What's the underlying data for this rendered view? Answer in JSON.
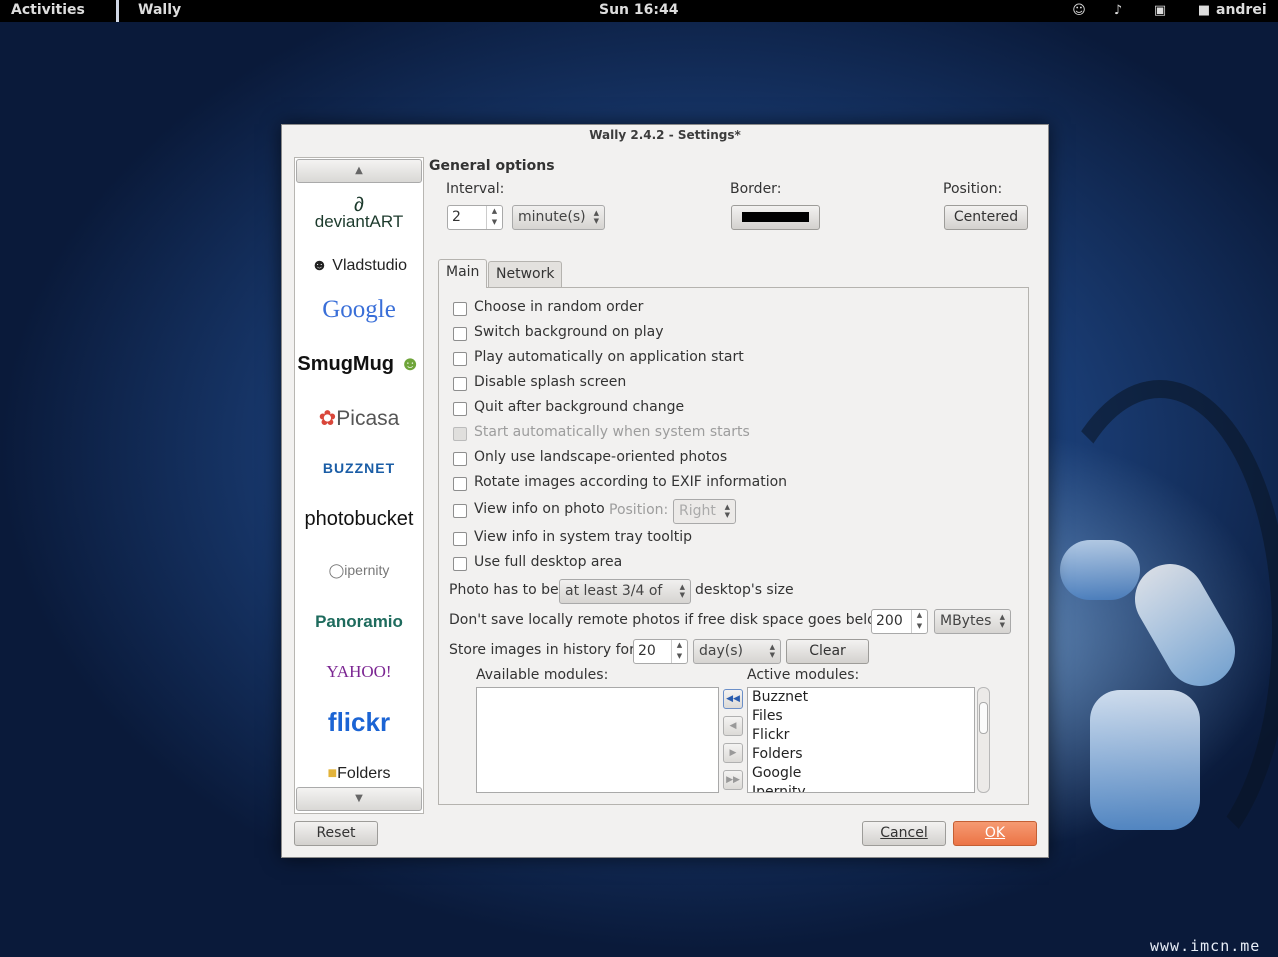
{
  "topbar": {
    "activities": "Activities",
    "app_name": "Wally",
    "clock": "Sun 16:44",
    "user": "andrei"
  },
  "watermark": "www.imcn.me",
  "window": {
    "title": "Wally 2.4.2 - Settings*"
  },
  "sidebar": {
    "sources": [
      {
        "label": "deviantART"
      },
      {
        "label": "Vladstudio"
      },
      {
        "label": "Google"
      },
      {
        "label": "SmugMug"
      },
      {
        "label": "Picasa"
      },
      {
        "label": "BUZZNET"
      },
      {
        "label": "photobucket"
      },
      {
        "label": "ipernity"
      },
      {
        "label": "Panoramio"
      },
      {
        "label": "YAHOO!"
      },
      {
        "label": "flickr"
      },
      {
        "label": "Folders"
      }
    ]
  },
  "general": {
    "heading": "General options",
    "interval_label": "Interval:",
    "interval_value": "2",
    "interval_unit": "minute(s)",
    "border_label": "Border:",
    "border_color": "#000000",
    "position_label": "Position:",
    "position_value": "Centered"
  },
  "tabs": {
    "main": "Main",
    "network": "Network"
  },
  "options": {
    "random_order": "Choose in random order",
    "switch_on_play": "Switch background on play",
    "play_on_start": "Play automatically on application start",
    "disable_splash": "Disable splash screen",
    "quit_after_change": "Quit after background change",
    "start_with_system": "Start automatically when system starts",
    "landscape_only": "Only use landscape-oriented photos",
    "rotate_exif": "Rotate images according to EXIF information",
    "view_info": "View info on photo",
    "view_info_position_label": "Position:",
    "view_info_position_value": "Right",
    "tray_tooltip": "View info in system tray tooltip",
    "full_desktop": "Use full desktop area"
  },
  "size": {
    "prefix": "Photo has to be",
    "value": "at least 3/4 of",
    "suffix": "desktop's size"
  },
  "disk": {
    "label": "Don't save locally remote photos if free disk space goes below",
    "value": "200",
    "unit": "MBytes"
  },
  "history": {
    "label": "Store images in history for",
    "value": "20",
    "unit": "day(s)",
    "clear": "Clear"
  },
  "modules": {
    "available_label": "Available modules:",
    "active_label": "Active modules:",
    "active": [
      "Buzznet",
      "Files",
      "Flickr",
      "Folders",
      "Google",
      "Ipernity"
    ]
  },
  "buttons": {
    "reset": "Reset",
    "cancel": "Cancel",
    "ok": "OK"
  }
}
